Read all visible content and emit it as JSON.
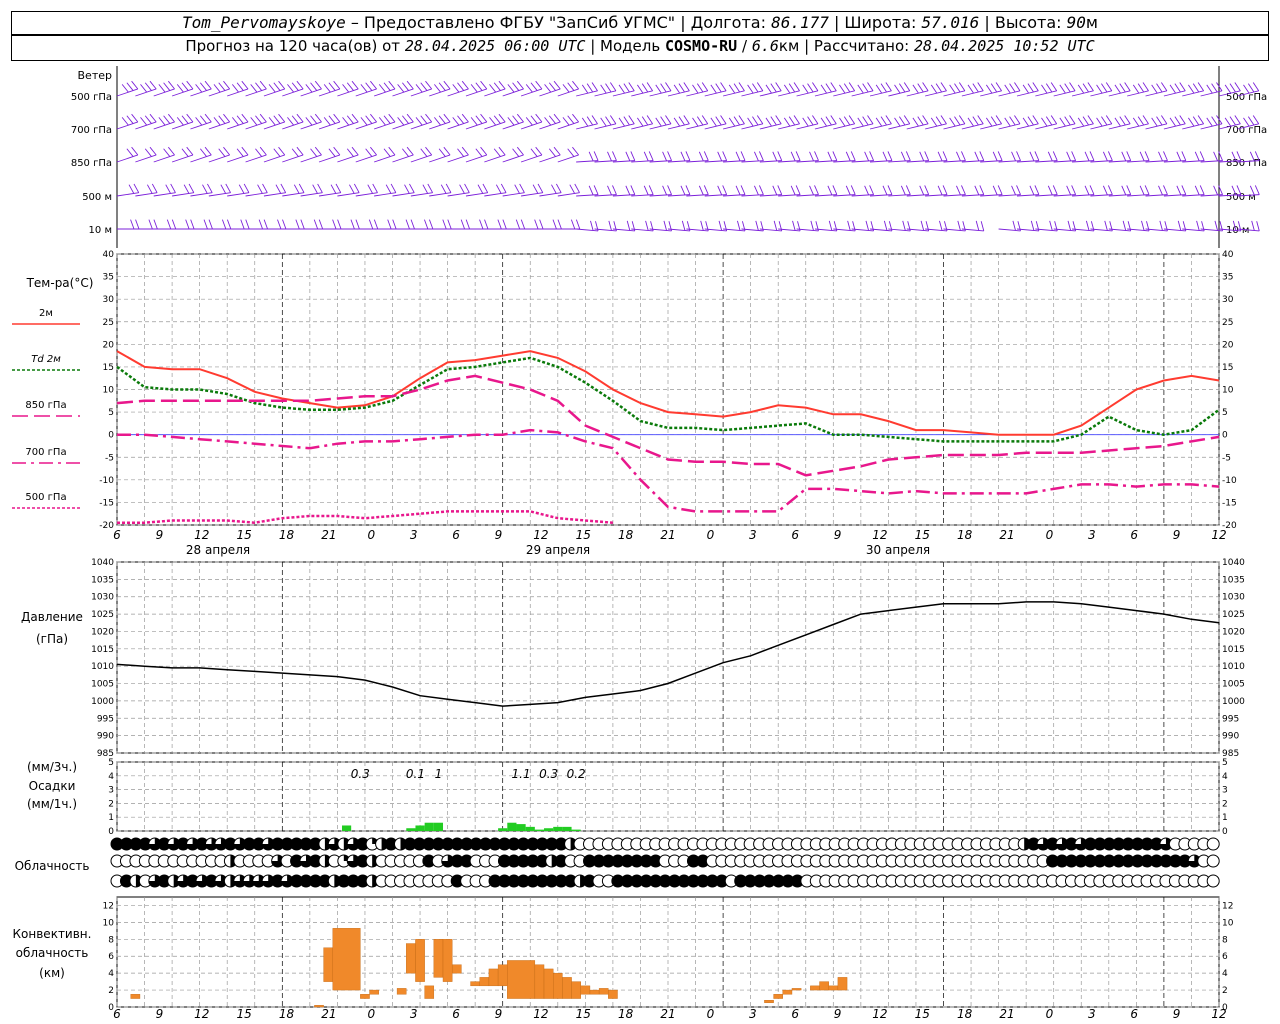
{
  "header": {
    "station": "Tom_Pervomayskoye",
    "provided": "– Предоставлено ФГБУ \"ЗапСиб УГМС\"",
    "lon_label": "Долгота:",
    "lon_value": "86.177",
    "lat_label": "Широта:",
    "lat_value": "57.016",
    "alt_label": "Высота:",
    "alt_value": "90",
    "alt_unit": "м",
    "forecast_prefix": "Прогноз на 120 часа(ов) от",
    "forecast_start": "28.04.2025 06:00 UTC",
    "model_label": "Модель",
    "model_name": "COSMO-RU",
    "model_res": "6.6",
    "model_res_unit": "км",
    "calc_label": "Рассчитано:",
    "calc_time": "28.04.2025 10:52 UTC"
  },
  "colors": {
    "t2m": "#ff3b30",
    "td2m": "#0a7a0a",
    "t850": "#e8178c",
    "t700": "#e8178c",
    "t500": "#e8178c",
    "wind": "#7b1fd9",
    "precip": "#22cc22",
    "convective": "#f0892a",
    "pressure": "#000000",
    "zero_line": "#4444ff"
  },
  "wind_panel": {
    "title": "Ветер",
    "levels": [
      "500 гПа",
      "700 гПа",
      "850 гПа",
      "500 м",
      "10 м"
    ]
  },
  "time_axis": {
    "hour_ticks": [
      "6",
      "9",
      "12",
      "15",
      "18",
      "21",
      "0",
      "3",
      "6",
      "9",
      "12",
      "15",
      "18",
      "21",
      "0",
      "3",
      "6",
      "9",
      "12",
      "15",
      "18",
      "21",
      "0",
      "3",
      "6",
      "9",
      "12"
    ],
    "day_labels": [
      "28 апреля",
      "29 апреля",
      "30 апреля"
    ]
  },
  "chart_data": [
    {
      "type": "line",
      "panel": "temperature",
      "ylabel": "Тем-ра(°C)",
      "ylim": [
        -20,
        40
      ],
      "yticks": [
        -20,
        -15,
        -10,
        -5,
        0,
        5,
        10,
        15,
        20,
        25,
        30,
        35,
        40
      ],
      "x_hours": [
        0,
        3,
        6,
        9,
        12,
        15,
        18,
        21,
        24,
        27,
        30,
        33,
        36,
        39,
        42,
        45,
        48,
        51,
        54,
        57,
        60,
        63,
        66,
        69,
        72,
        75,
        78,
        81,
        84,
        87,
        90,
        93,
        96,
        99,
        102,
        105,
        108,
        111,
        114,
        117,
        120
      ],
      "series": [
        {
          "name": "2м",
          "values": [
            18.5,
            15,
            14.5,
            14.5,
            12.5,
            9.5,
            8,
            7,
            6,
            6.5,
            8.5,
            12.5,
            16,
            16.5,
            17.5,
            18.5,
            17,
            14,
            10,
            7,
            5,
            4.5,
            4,
            5,
            6.5,
            6,
            4.5,
            4.5,
            3,
            1,
            1,
            0.5,
            0,
            0,
            0,
            2,
            6,
            10,
            12,
            13,
            12
          ]
        },
        {
          "name": "Td 2м",
          "values": [
            15,
            10.5,
            10,
            10,
            9,
            7,
            6,
            5.5,
            5.5,
            6,
            7.5,
            11,
            14.5,
            15,
            16,
            17,
            15,
            11.5,
            7.5,
            3,
            1.5,
            1.5,
            1,
            1.5,
            2,
            2.5,
            0,
            0,
            -0.5,
            -1,
            -1.5,
            -1.5,
            -1.5,
            -1.5,
            -1.5,
            0,
            4,
            1,
            0,
            1,
            5.5
          ]
        },
        {
          "name": "850 гПа",
          "values": [
            7,
            7.5,
            7.5,
            7.5,
            7.5,
            7.5,
            7.5,
            7.5,
            8,
            8.5,
            8.5,
            10,
            12,
            13,
            11.5,
            10,
            7.5,
            2,
            -0.5,
            -3,
            -5.5,
            -6,
            -6,
            -6.5,
            -6.5,
            -9,
            -8,
            -7,
            -5.5,
            -5,
            -4.5,
            -4.5,
            -4.5,
            -4,
            -4,
            -4,
            -3.5,
            -3,
            -2.5,
            -1.5,
            -0.5
          ]
        },
        {
          "name": "700 гПа",
          "values": [
            0,
            0,
            -0.5,
            -1,
            -1.5,
            -2,
            -2.5,
            -3,
            -2,
            -1.5,
            -1.5,
            -1,
            -0.5,
            0,
            0,
            1,
            0.5,
            -1.5,
            -3,
            -10,
            -16,
            -17,
            -17,
            -17,
            -17,
            -12,
            -12,
            -12.5,
            -13,
            -12.5,
            -13,
            -13,
            -13,
            -13,
            -12,
            -11,
            -11,
            -11.5,
            -11,
            -11,
            -11.5
          ]
        },
        {
          "name": "500 гПа",
          "values": [
            -19.5,
            -19.5,
            -19,
            -19,
            -19,
            -19.5,
            -18.5,
            -18,
            -18,
            -18.5,
            -18,
            -17.5,
            -17,
            -17,
            -17,
            -17,
            -18.5,
            -19,
            -19.5,
            null,
            null,
            null,
            null,
            null,
            null,
            null,
            null,
            null,
            null,
            null,
            null,
            null,
            null,
            null,
            null,
            null,
            null,
            null,
            null,
            null,
            null
          ]
        }
      ]
    },
    {
      "type": "line",
      "panel": "pressure",
      "ylabel": "Давление",
      "yunit": "(гПа)",
      "ylim": [
        985,
        1040
      ],
      "yticks": [
        985,
        990,
        995,
        1000,
        1005,
        1010,
        1015,
        1020,
        1025,
        1030,
        1035,
        1040
      ],
      "x_hours": [
        0,
        3,
        6,
        9,
        12,
        15,
        18,
        21,
        24,
        27,
        30,
        33,
        36,
        39,
        42,
        45,
        48,
        51,
        54,
        57,
        60,
        63,
        66,
        69,
        72,
        75,
        78,
        81,
        84,
        87,
        90,
        93,
        96,
        99,
        102,
        105,
        108,
        111,
        114,
        117,
        120
      ],
      "series": [
        {
          "name": "Давление",
          "values": [
            1010.5,
            1010,
            1009.5,
            1009.5,
            1009,
            1008.5,
            1008,
            1007.5,
            1007,
            1006,
            1004,
            1001.5,
            1000.5,
            999.5,
            998.5,
            999,
            999.5,
            1001,
            1002,
            1003,
            1005,
            1008,
            1011,
            1013,
            1016,
            1019,
            1022,
            1025,
            1026,
            1027,
            1028,
            1028,
            1028,
            1028.5,
            1028.5,
            1028,
            1027,
            1026,
            1025,
            1023.5,
            1022.5
          ]
        }
      ]
    },
    {
      "type": "bar",
      "panel": "precipitation",
      "ylabel": "(мм/3ч.)",
      "ylabel2": "Осадки",
      "ylabel3": "(мм/1ч.)",
      "ylim": [
        0,
        5
      ],
      "yticks": [
        0,
        1,
        2,
        3,
        4,
        5
      ],
      "totals": [
        {
          "hour": 26.5,
          "label": "0.3"
        },
        {
          "hour": 32.5,
          "label": "0.1"
        },
        {
          "hour": 35,
          "label": "1"
        },
        {
          "hour": 44,
          "label": "1.1"
        },
        {
          "hour": 47,
          "label": "0.3"
        },
        {
          "hour": 50,
          "label": "0.2"
        }
      ],
      "bars": [
        {
          "hour": 25,
          "value": 0.4
        },
        {
          "hour": 32,
          "value": 0.2
        },
        {
          "hour": 33,
          "value": 0.4
        },
        {
          "hour": 34,
          "value": 0.6
        },
        {
          "hour": 35,
          "value": 0.6
        },
        {
          "hour": 42,
          "value": 0.2
        },
        {
          "hour": 43,
          "value": 0.6
        },
        {
          "hour": 44,
          "value": 0.5
        },
        {
          "hour": 45,
          "value": 0.3
        },
        {
          "hour": 46,
          "value": 0.1
        },
        {
          "hour": 47,
          "value": 0.2
        },
        {
          "hour": 48,
          "value": 0.3
        },
        {
          "hour": 49,
          "value": 0.3
        },
        {
          "hour": 50,
          "value": 0.1
        }
      ]
    },
    {
      "type": "bar",
      "panel": "convective",
      "ylabel": "Конвективн.",
      "ylabel2": "облачность",
      "ylabel3": "(км)",
      "ylim": [
        0,
        13
      ],
      "yticks": [
        0,
        2,
        4,
        6,
        8,
        10,
        12
      ],
      "bars": [
        {
          "h0": 1.5,
          "h1": 2.5,
          "base": 1,
          "top": 1.5
        },
        {
          "h0": 21.5,
          "h1": 22.5,
          "base": 0,
          "top": 0.2
        },
        {
          "h0": 22.5,
          "h1": 23.5,
          "base": 3,
          "top": 7
        },
        {
          "h0": 23.5,
          "h1": 26.5,
          "base": 2,
          "top": 9.3
        },
        {
          "h0": 26.5,
          "h1": 27.5,
          "base": 1,
          "top": 1.5
        },
        {
          "h0": 27.5,
          "h1": 28.5,
          "base": 1.5,
          "top": 2
        },
        {
          "h0": 30.5,
          "h1": 31.5,
          "base": 1.5,
          "top": 2.2
        },
        {
          "h0": 31.5,
          "h1": 32.5,
          "base": 4,
          "top": 7.5
        },
        {
          "h0": 32.5,
          "h1": 33.5,
          "base": 3,
          "top": 8
        },
        {
          "h0": 33.5,
          "h1": 34.5,
          "base": 1,
          "top": 2.5
        },
        {
          "h0": 34.5,
          "h1": 35.5,
          "base": 3.5,
          "top": 8
        },
        {
          "h0": 35.5,
          "h1": 36.5,
          "base": 3,
          "top": 8
        },
        {
          "h0": 36.5,
          "h1": 37.5,
          "base": 4,
          "top": 5
        },
        {
          "h0": 38.5,
          "h1": 39.5,
          "base": 2.5,
          "top": 3
        },
        {
          "h0": 39.5,
          "h1": 40.5,
          "base": 2.5,
          "top": 3.5
        },
        {
          "h0": 40.5,
          "h1": 41.5,
          "base": 2.5,
          "top": 4.5
        },
        {
          "h0": 41.5,
          "h1": 42.5,
          "base": 2.5,
          "top": 5
        },
        {
          "h0": 42.5,
          "h1": 45.5,
          "base": 1,
          "top": 5.5
        },
        {
          "h0": 45.5,
          "h1": 46.5,
          "base": 1,
          "top": 5
        },
        {
          "h0": 46.5,
          "h1": 47.5,
          "base": 1,
          "top": 4.5
        },
        {
          "h0": 47.5,
          "h1": 48.5,
          "base": 1,
          "top": 4
        },
        {
          "h0": 48.5,
          "h1": 49.5,
          "base": 1,
          "top": 3.5
        },
        {
          "h0": 49.5,
          "h1": 50.5,
          "base": 1,
          "top": 3
        },
        {
          "h0": 50.5,
          "h1": 51.5,
          "base": 1.5,
          "top": 2.5
        },
        {
          "h0": 51.5,
          "h1": 52.5,
          "base": 1.5,
          "top": 2
        },
        {
          "h0": 52.5,
          "h1": 53.5,
          "base": 1.5,
          "top": 2.2
        },
        {
          "h0": 53.5,
          "h1": 54.5,
          "base": 1,
          "top": 2
        },
        {
          "h0": 70.5,
          "h1": 71.5,
          "base": 0.5,
          "top": 0.8
        },
        {
          "h0": 71.5,
          "h1": 72.5,
          "base": 1,
          "top": 1.5
        },
        {
          "h0": 72.5,
          "h1": 73.5,
          "base": 1.5,
          "top": 2
        },
        {
          "h0": 73.5,
          "h1": 74.5,
          "base": 2,
          "top": 2.2
        },
        {
          "h0": 75.5,
          "h1": 76.5,
          "base": 2,
          "top": 2.5
        },
        {
          "h0": 76.5,
          "h1": 77.5,
          "base": 2,
          "top": 3
        },
        {
          "h0": 77.5,
          "h1": 78.5,
          "base": 2,
          "top": 2.5
        },
        {
          "h0": 78.5,
          "h1": 79.5,
          "base": 2,
          "top": 3.5
        }
      ]
    }
  ],
  "clouds": {
    "title": "Облачность",
    "rows": [
      "4444343434334344344444232341242444444444444444442000000000000000000000000000000000000000000000002434343444444443000000",
      "0000000000002000030434201342000004034400044444240044444444000440000000000000000000000000000000000004444444444444443000",
      "0420342343432333343444424442000000004000444444444240044444444444404444444000000000000000000000000000000000000000000000"
    ]
  }
}
